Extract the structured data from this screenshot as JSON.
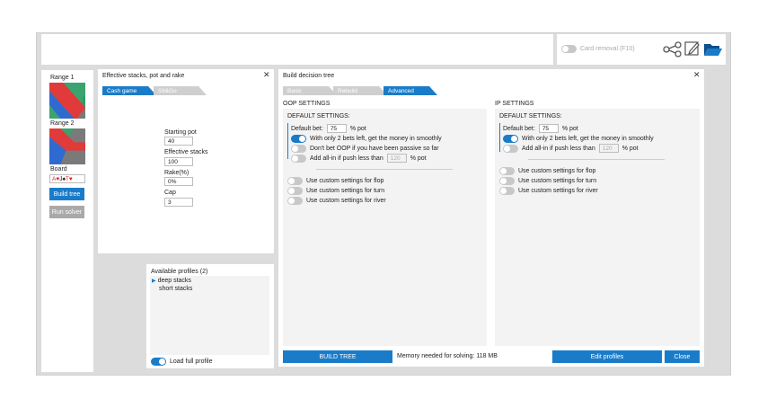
{
  "top_bar": {
    "card_removal_label": "Card removal (F10)"
  },
  "side": {
    "range1_label": "Range 1",
    "range2_label": "Range 2",
    "board_label": "Board",
    "board_cards": [
      {
        "rank": "A",
        "suit": "♥",
        "color": "#d22"
      },
      {
        "rank": "J",
        "suit": "♠",
        "color": "#111"
      },
      {
        "rank": "T",
        "suit": "♥",
        "color": "#d22"
      }
    ],
    "build_tree_button": "Build tree",
    "run_solver_button": "Run solver"
  },
  "stacks_panel": {
    "title": "Effective stacks, pot and rake",
    "tabs": [
      "Cash game",
      "Sit&Go"
    ],
    "starting_pot_label": "Starting pot",
    "starting_pot_value": "40",
    "effective_stacks_label": "Effective stacks",
    "effective_stacks_value": "100",
    "rake_label": "Rake(%)",
    "rake_value": "0%",
    "cap_label": "Cap",
    "cap_value": "3"
  },
  "profiles_panel": {
    "title": "Available profiles (2)",
    "items": [
      "deep stacks",
      "short stacks"
    ],
    "load_full_profile_label": "Load full profile"
  },
  "tree_panel": {
    "title": "Build decision tree",
    "tabs": [
      "Basic",
      "Rebuild",
      "Advanced"
    ],
    "oop": {
      "title": "OOP SETTINGS",
      "default_settings": "DEFAULT SETTINGS:",
      "default_bet_label": "Default bet:",
      "default_bet_value": "75",
      "pot_suffix": "% pot",
      "two_bets_label": "With only 2 bets left, get the money in smoothly",
      "dont_bet_label": "Don't bet OOP if you have been passive so far",
      "allin_label": "Add all-in if push less than",
      "allin_value": "120",
      "allin_suffix": "% pot",
      "flop_label": "Use custom settings for flop",
      "turn_label": "Use custom settings for turn",
      "river_label": "Use custom settings for river"
    },
    "ip": {
      "title": "IP SETTINGS",
      "default_settings": "DEFAULT SETTINGS:",
      "default_bet_label": "Default bet:",
      "default_bet_value": "75",
      "pot_suffix": "% pot",
      "two_bets_label": "With only 2 bets left, get the money in smoothly",
      "allin_label": "Add all-in if push less than",
      "allin_value": "120",
      "allin_suffix": "% pot",
      "flop_label": "Use custom settings for flop",
      "turn_label": "Use custom settings for turn",
      "river_label": "Use custom settings for river"
    },
    "build_tree_button": "BUILD TREE",
    "memory_text": "Memory needed for solving: 118 MB",
    "edit_profiles_button": "Edit profiles",
    "close_button": "Close"
  },
  "colors": {
    "accent": "#1a7cc9"
  }
}
